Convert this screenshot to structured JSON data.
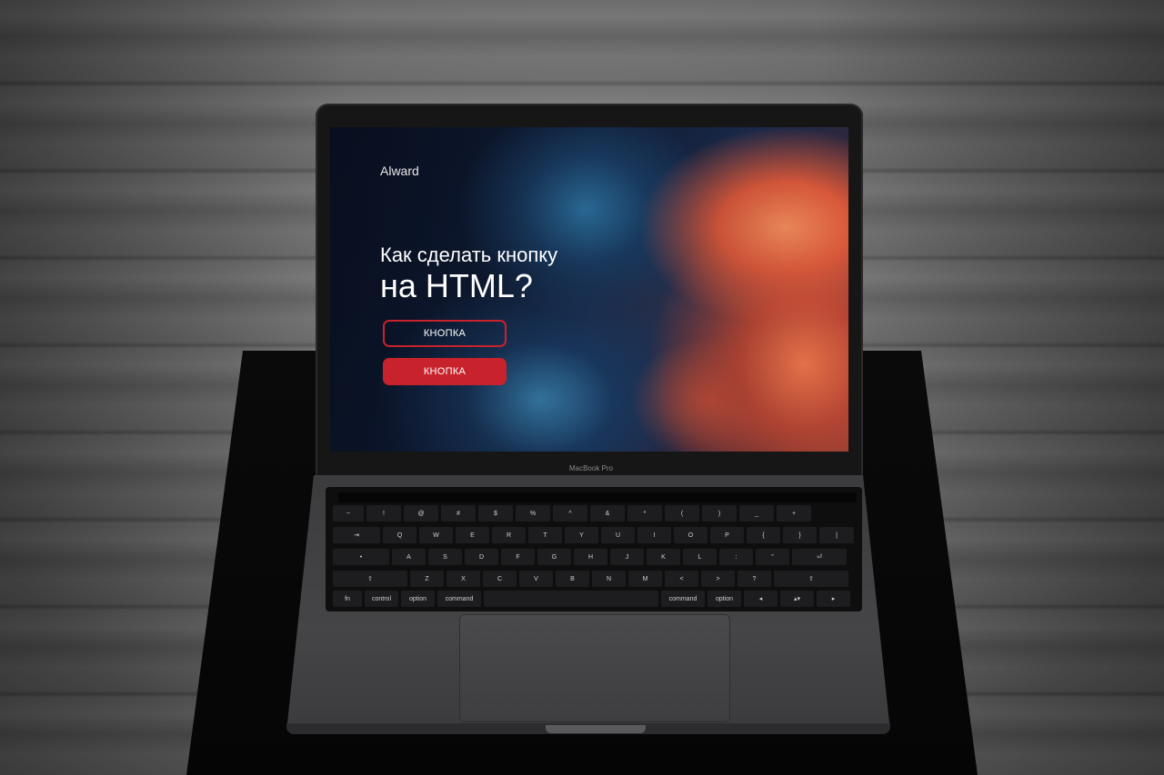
{
  "website": {
    "brand": "Alward",
    "headline_line1": "Как сделать кнопку",
    "headline_line2": "на HTML?",
    "button_outline_label": "КНОПКА",
    "button_filled_label": "КНОПКА",
    "accent_color": "#c8232c"
  },
  "device": {
    "model_label": "MacBook Pro"
  },
  "keyboard": {
    "row_numbers": [
      "~",
      "!",
      "@",
      "#",
      "$",
      "%",
      "^",
      "&",
      "*",
      "(",
      ")",
      "_",
      "+"
    ],
    "row_top": [
      "Q",
      "W",
      "E",
      "R",
      "T",
      "Y",
      "U",
      "I",
      "O",
      "P",
      "{",
      "}",
      "|"
    ],
    "row_home": [
      "A",
      "S",
      "D",
      "F",
      "G",
      "H",
      "J",
      "K",
      "L",
      ":",
      "\""
    ],
    "row_bottom": [
      "Z",
      "X",
      "C",
      "V",
      "B",
      "N",
      "M",
      "<",
      ">",
      "?"
    ],
    "row_modifiers": [
      "fn",
      "control",
      "option",
      "command",
      "",
      "command",
      "option"
    ]
  }
}
